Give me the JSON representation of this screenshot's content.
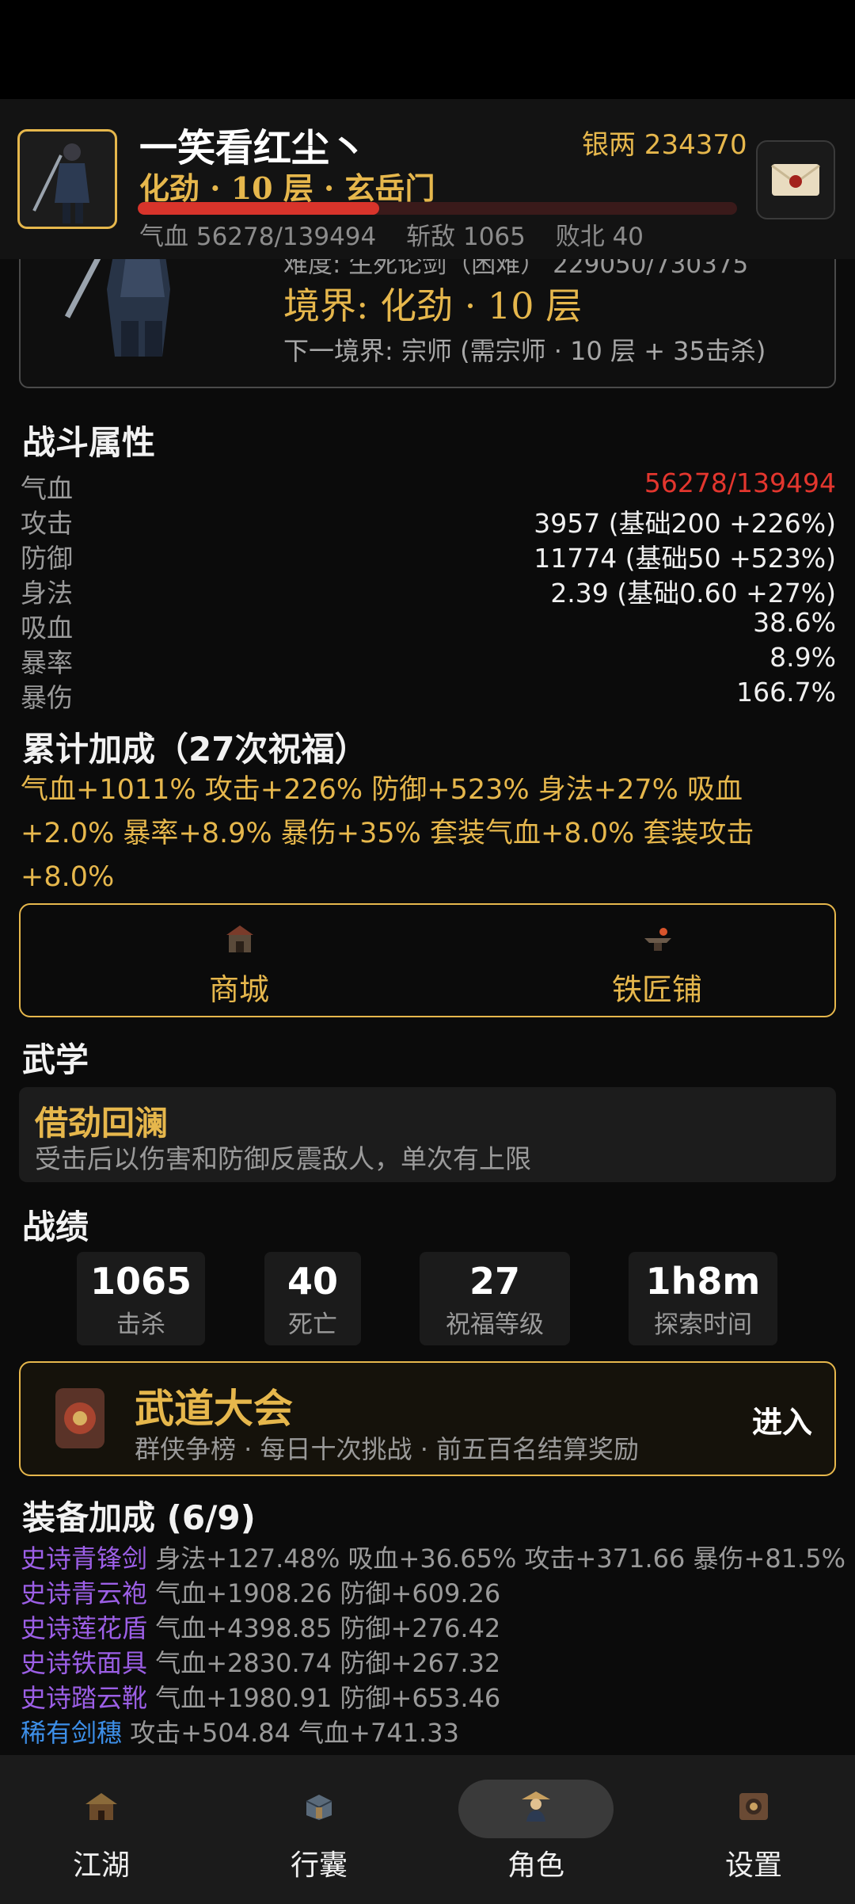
{
  "header": {
    "name": "一笑看红尘丶",
    "silver": "银两 234370",
    "realm_line": "化劲 · 10 层 · 玄岳门",
    "hp_fraction": 0.4035,
    "hp_text": "气血 56278/139494",
    "kills_text": "斩敌 1065",
    "defeats_text": "败北 40"
  },
  "profile": {
    "difficulty": "难度: 生死论剑（困难） 229050/730375",
    "realm": "境界: 化劲 · 10 层",
    "next_realm": "下一境界: 宗师 (需宗师 · 10 层 + 35击杀)"
  },
  "combat": {
    "title": "战斗属性",
    "rows": [
      {
        "label": "气血",
        "value": "56278/139494"
      },
      {
        "label": "攻击",
        "value": "3957 (基础200 +226%)"
      },
      {
        "label": "防御",
        "value": "11774 (基础50 +523%)"
      },
      {
        "label": "身法",
        "value": "2.39 (基础0.60 +27%)"
      },
      {
        "label": "吸血",
        "value": "38.6%"
      },
      {
        "label": "暴率",
        "value": "8.9%"
      },
      {
        "label": "暴伤",
        "value": "166.7%"
      }
    ]
  },
  "bonus": {
    "title": "累计加成（27次祝福）",
    "text": "气血+1011% 攻击+226% 防御+523% 身法+27% 吸血+2.0% 暴率+8.9% 暴伤+35% 套装气血+8.0% 套装攻击+8.0%"
  },
  "shops": {
    "mall": "商城",
    "smithy": "铁匠铺"
  },
  "martial": {
    "title": "武学",
    "skill_name": "借劲回澜",
    "skill_desc": "受击后以伤害和防御反震敌人，单次有上限"
  },
  "records": {
    "title": "战绩",
    "items": [
      {
        "value": "1065",
        "label": "击杀"
      },
      {
        "value": "40",
        "label": "死亡"
      },
      {
        "value": "27",
        "label": "祝福等级"
      },
      {
        "value": "1h8m",
        "label": "探索时间"
      }
    ]
  },
  "tournament": {
    "title": "武道大会",
    "subtitle": "群侠争榜 · 每日十次挑战 · 前五百名结算奖励",
    "enter": "进入"
  },
  "equipment": {
    "title": "装备加成 (6/9)",
    "items": [
      {
        "name": "史诗青锋剑",
        "desc": "身法+127.48% 吸血+36.65% 攻击+371.66 暴伤+81.5%",
        "rarity": "epic"
      },
      {
        "name": "史诗青云袍",
        "desc": "气血+1908.26 防御+609.26",
        "rarity": "epic"
      },
      {
        "name": "史诗莲花盾",
        "desc": "气血+4398.85 防御+276.42",
        "rarity": "epic"
      },
      {
        "name": "史诗铁面具",
        "desc": "气血+2830.74 防御+267.32",
        "rarity": "epic"
      },
      {
        "name": "史诗踏云靴",
        "desc": "气血+1980.91 防御+653.46",
        "rarity": "epic"
      },
      {
        "name": "稀有剑穗",
        "desc": "攻击+504.84 气血+741.33",
        "rarity": "rare"
      }
    ]
  },
  "nav": {
    "items": [
      {
        "label": "江湖",
        "icon": "jianghu-icon"
      },
      {
        "label": "行囊",
        "icon": "bag-icon"
      },
      {
        "label": "角色",
        "icon": "character-icon",
        "active": true
      },
      {
        "label": "设置",
        "icon": "settings-icon"
      }
    ]
  },
  "colors": {
    "accent": "#e6b74c",
    "hp_red": "#d8342b",
    "epic": "#9c5fe6",
    "rare": "#3d8fe8",
    "background": "#0b0b0b"
  }
}
